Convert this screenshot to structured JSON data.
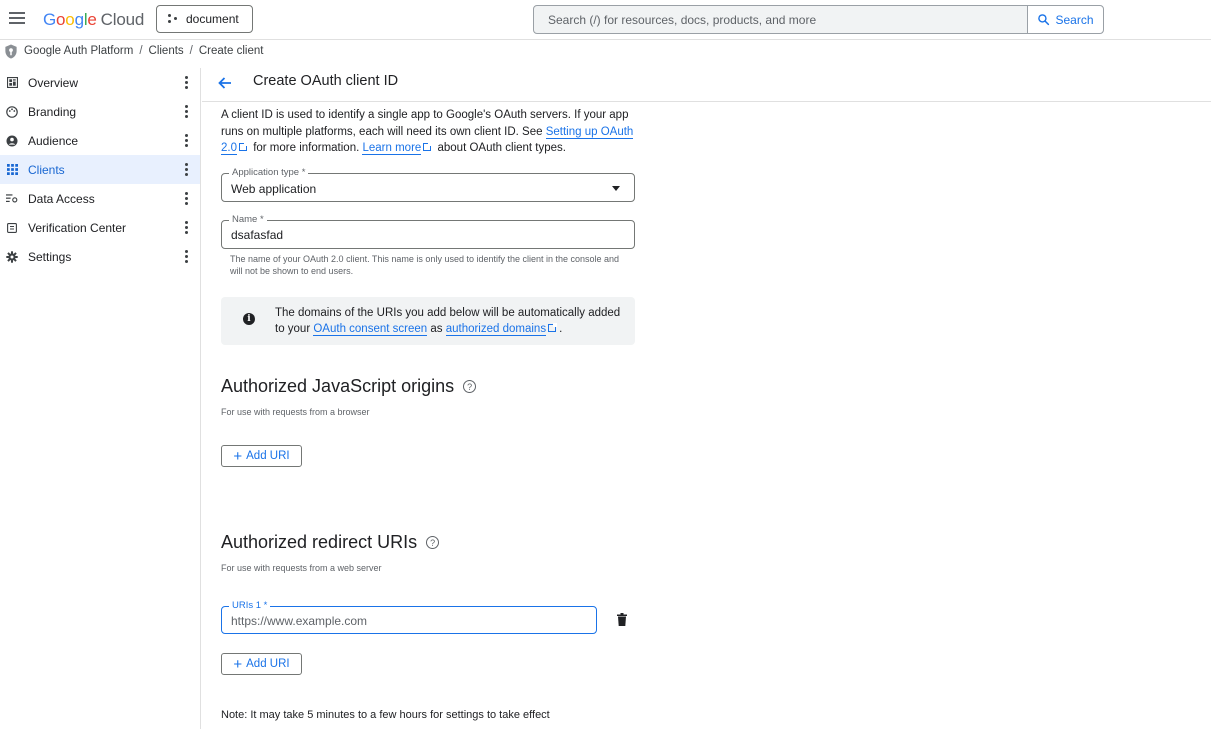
{
  "header": {
    "logo_google": "Google",
    "logo_cloud": "Cloud",
    "project_label": "document",
    "search_placeholder": "Search (/) for resources, docs, products, and more",
    "search_button": "Search"
  },
  "breadcrumb": {
    "items": [
      "Google Auth Platform",
      "Clients",
      "Create client"
    ],
    "separator": "/"
  },
  "sidebar": {
    "items": [
      {
        "label": "Overview",
        "icon": "dashboard-icon"
      },
      {
        "label": "Branding",
        "icon": "palette-icon"
      },
      {
        "label": "Audience",
        "icon": "person-icon"
      },
      {
        "label": "Clients",
        "icon": "apps-grid-icon",
        "active": true
      },
      {
        "label": "Data Access",
        "icon": "data-filter-icon"
      },
      {
        "label": "Verification Center",
        "icon": "verification-icon"
      },
      {
        "label": "Settings",
        "icon": "gear-icon"
      }
    ]
  },
  "page": {
    "title": "Create OAuth client ID",
    "intro_part1": "A client ID is used to identify a single app to Google's OAuth servers. If your app runs on multiple platforms, each will need its own client ID. See ",
    "intro_link1": "Setting up OAuth 2.0",
    "intro_part2": " for more information. ",
    "intro_link2": "Learn more",
    "intro_part3": " about OAuth client types."
  },
  "form": {
    "app_type_label": "Application type *",
    "app_type_value": "Web application",
    "name_label": "Name *",
    "name_value": "dsafasfad",
    "name_hint": "The name of your OAuth 2.0 client. This name is only used to identify the client in the console and will not be shown to end users."
  },
  "info": {
    "text1": "The domains of the URIs you add below will be automatically added to your ",
    "link1": "OAuth consent screen",
    "text2": " as ",
    "link2": "authorized domains",
    "text3": "."
  },
  "js_origins": {
    "title": "Authorized JavaScript origins",
    "subtitle": "For use with requests from a browser",
    "add_label": "Add URI"
  },
  "redirect_uris": {
    "title": "Authorized redirect URIs",
    "subtitle": "For use with requests from a web server",
    "uri_label": "URIs 1 *",
    "uri_placeholder": "https://www.example.com",
    "add_label": "Add URI"
  },
  "note": "Note: It may take 5 minutes to a few hours for settings to take effect",
  "colors": {
    "accent": "#1a73e8",
    "active_bg": "#e8f0fe",
    "info_bg": "#f1f3f4"
  }
}
